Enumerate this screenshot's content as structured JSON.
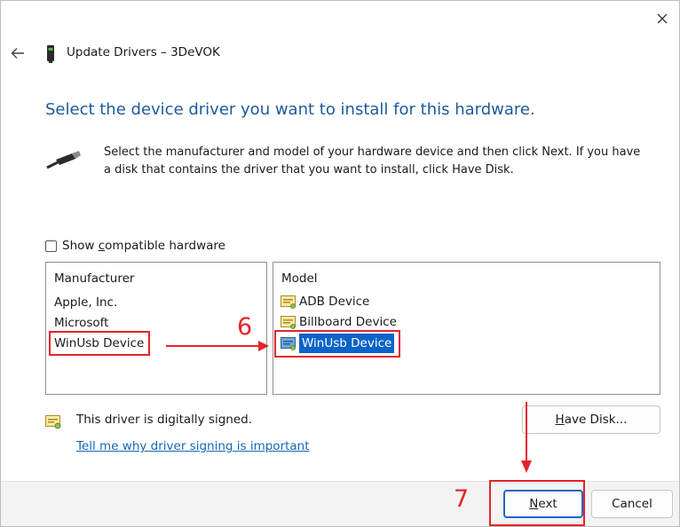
{
  "window": {
    "title": "Update Drivers – 3DeVOK",
    "close_icon": "close-icon",
    "back_icon": "back-arrow-icon"
  },
  "heading": "Select the device driver you want to install for this hardware.",
  "description": "Select the manufacturer and model of your hardware device and then click Next. If you have a disk that contains the driver that you want to install, click Have Disk.",
  "show_compatible": {
    "label_pre": "Show ",
    "label_underline": "c",
    "label_post": "ompatible hardware",
    "checked": false
  },
  "manufacturer": {
    "header": "Manufacturer",
    "items": [
      "Apple, Inc.",
      "Microsoft",
      "WinUsb Device"
    ],
    "selected": "WinUsb Device"
  },
  "model": {
    "header": "Model",
    "items": [
      "ADB Device",
      "Billboard Device",
      "WinUsb Device"
    ],
    "selected": "WinUsb Device"
  },
  "annotations": {
    "step6": "6",
    "step7": "7",
    "color": "#e5232b"
  },
  "signing": {
    "status": "This driver is digitally signed.",
    "link": "Tell me why driver signing is important"
  },
  "buttons": {
    "have_disk_underline": "H",
    "have_disk_rest": "ave Disk...",
    "next_underline": "N",
    "next_rest": "ext",
    "cancel": "Cancel"
  },
  "colors": {
    "heading": "#1c5a9e",
    "link": "#1466b8",
    "selection": "#0a64c8"
  }
}
